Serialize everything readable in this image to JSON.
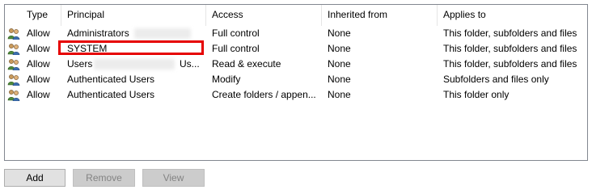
{
  "columns": {
    "type": "Type",
    "principal": "Principal",
    "access": "Access",
    "inherited": "Inherited from",
    "applies": "Applies to"
  },
  "entries": [
    {
      "type": "Allow",
      "principal": "Administrators",
      "access": "Full control",
      "inherited": "None",
      "applies": "This folder, subfolders and files"
    },
    {
      "type": "Allow",
      "principal": "SYSTEM",
      "access": "Full control",
      "inherited": "None",
      "applies": "This folder, subfolders and files"
    },
    {
      "type": "Allow",
      "principal": "Users",
      "principal_suffix": "Us...",
      "access": "Read & execute",
      "inherited": "None",
      "applies": "This folder, subfolders and files"
    },
    {
      "type": "Allow",
      "principal": "Authenticated Users",
      "access": "Modify",
      "inherited": "None",
      "applies": "Subfolders and files only"
    },
    {
      "type": "Allow",
      "principal": "Authenticated Users",
      "access": "Create folders / appen...",
      "inherited": "None",
      "applies": "This folder only"
    }
  ],
  "buttons": {
    "add": "Add",
    "remove": "Remove",
    "view": "View"
  },
  "colors": {
    "highlight": "#e60000",
    "list_border": "#828790"
  },
  "icons": {
    "entry": "users-icon"
  }
}
